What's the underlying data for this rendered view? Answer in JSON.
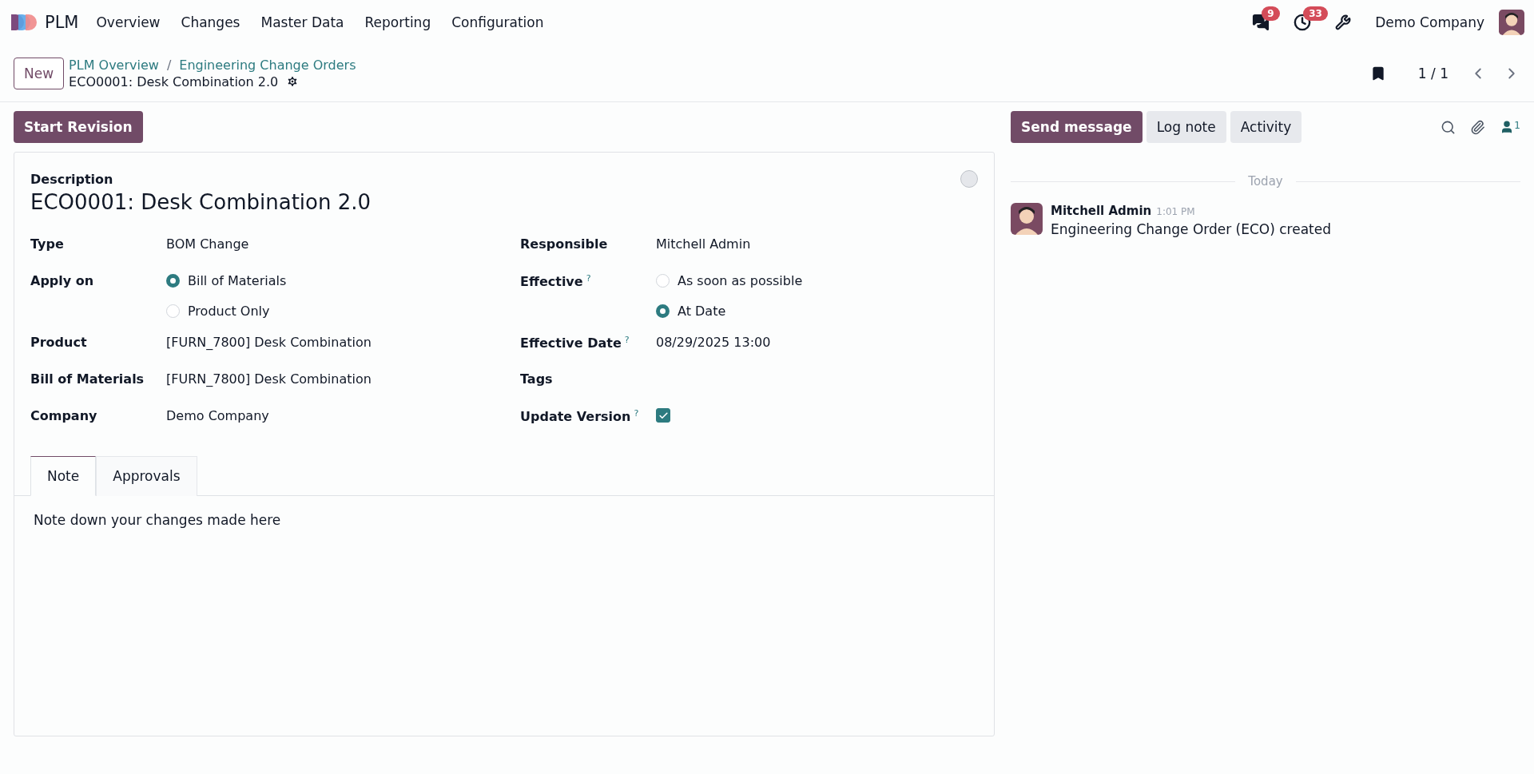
{
  "navbar": {
    "app": "PLM",
    "menu": [
      "Overview",
      "Changes",
      "Master Data",
      "Reporting",
      "Configuration"
    ],
    "messages_badge": "9",
    "activities_badge": "33",
    "company": "Demo Company"
  },
  "control_panel": {
    "new_button": "New",
    "breadcrumbs": [
      "PLM Overview",
      "Engineering Change Orders"
    ],
    "breadcrumb_separator": "/",
    "record_title": "ECO0001: Desk Combination 2.0",
    "pager": "1 / 1"
  },
  "status_button": "Start Revision",
  "form": {
    "description_label": "Description",
    "title": "ECO0001: Desk Combination 2.0",
    "done": false,
    "left_fields": [
      {
        "kind": "text",
        "label": "Type",
        "value": "BOM Change"
      },
      {
        "kind": "radio",
        "label": "Apply on",
        "options": [
          {
            "label": "Bill of Materials",
            "selected": true
          },
          {
            "label": "Product Only",
            "selected": false
          }
        ]
      },
      {
        "kind": "text",
        "label": "Product",
        "value": "[FURN_7800] Desk Combination"
      },
      {
        "kind": "text",
        "label": "Bill of Materials",
        "value": "[FURN_7800] Desk Combination"
      },
      {
        "kind": "text",
        "label": "Company",
        "value": "Demo Company"
      }
    ],
    "right_fields": [
      {
        "kind": "text",
        "label": "Responsible",
        "value": "Mitchell Admin"
      },
      {
        "kind": "radio",
        "label": "Effective",
        "help": "?",
        "options": [
          {
            "label": "As soon as possible",
            "selected": false
          },
          {
            "label": "At Date",
            "selected": true
          }
        ]
      },
      {
        "kind": "text",
        "label": "Effective Date",
        "help": "?",
        "value": "08/29/2025 13:00"
      },
      {
        "kind": "text",
        "label": "Tags"
      },
      {
        "kind": "checkbox",
        "label": "Update Version",
        "help": "?",
        "checked": true
      }
    ],
    "tabs": [
      {
        "label": "Note",
        "selected": true
      },
      {
        "label": "Approvals",
        "selected": false
      }
    ],
    "note": {
      "placeholder": "Note down your changes made here"
    }
  },
  "chatter": {
    "buttons": [
      {
        "label": "Send message",
        "primary": true
      },
      {
        "label": "Log note",
        "primary": false
      },
      {
        "label": "Activity",
        "primary": false
      }
    ],
    "followers_count": "1",
    "date_separator": "Today",
    "messages": [
      {
        "author": "Mitchell Admin",
        "time": "1:01 PM",
        "body": "Engineering Change Order (ECO) created"
      }
    ]
  }
}
